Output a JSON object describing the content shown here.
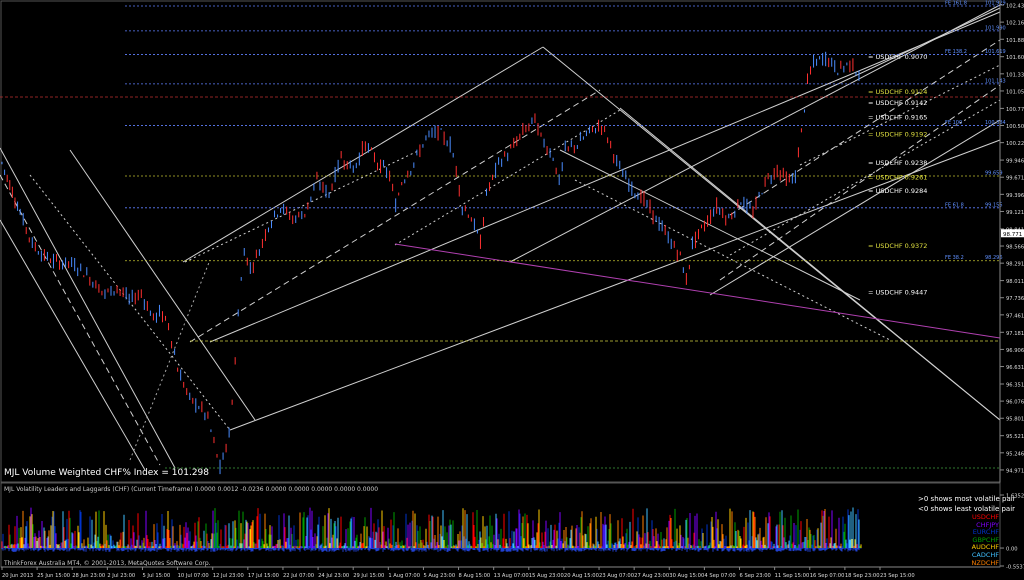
{
  "chart_data": [
    {
      "type": "candlestick",
      "symbol": "USDCHF",
      "indicator_title": "MJL Volume Weighted CHF% Index = 101.298",
      "ylim": [
        94.97,
        102.436
      ],
      "y_ticks": [
        "102.436",
        "102.161",
        "101.886",
        "101.606",
        "101.331",
        "101.056",
        "100.776",
        "100.501",
        "100.226",
        "99.946",
        "99.671",
        "99.396",
        "99.121",
        "98.841",
        "98.566",
        "98.291",
        "98.011",
        "97.736",
        "97.461",
        "97.181",
        "96.906",
        "96.631",
        "96.351",
        "96.076",
        "95.801",
        "95.521",
        "95.246",
        "94.971"
      ],
      "current_price": "98.771",
      "x_ticks": [
        "20 Jun 2013",
        "25 Jun 15:00",
        "28 Jun 23:00",
        "2 Jul 23:00",
        "5 Jul 15:00",
        "10 Jul 07:00",
        "12 Jul 23:00",
        "17 Jul 15:00",
        "22 Jul 07:00",
        "24 Jul 23:00",
        "29 Jul 15:00",
        "1 Aug 07:00",
        "5 Aug 23:00",
        "8 Aug 15:00",
        "13 Aug 07:00",
        "15 Aug 23:00",
        "20 Aug 15:00",
        "23 Aug 07:00",
        "27 Aug 23:00",
        "30 Aug 15:00",
        "4 Sep 07:00",
        "6 Sep 23:00",
        "11 Sep 15:00",
        "16 Sep 07:00",
        "18 Sep 23:00",
        "23 Sep 15:00"
      ],
      "price_path": [
        [
          0,
          99.9
        ],
        [
          6,
          99.1
        ],
        [
          10,
          98.6
        ],
        [
          14,
          98.4
        ],
        [
          18,
          98.3
        ],
        [
          22,
          98.3
        ],
        [
          26,
          98.2
        ],
        [
          30,
          98.0
        ],
        [
          34,
          97.8
        ],
        [
          38,
          97.9
        ],
        [
          42,
          97.7
        ],
        [
          46,
          97.8
        ],
        [
          48,
          97.6
        ],
        [
          50,
          97.4
        ],
        [
          52,
          97.5
        ],
        [
          55,
          97.3
        ],
        [
          58,
          96.6
        ],
        [
          62,
          96.1
        ],
        [
          65,
          96.0
        ],
        [
          68,
          95.8
        ],
        [
          70,
          95.4
        ],
        [
          72,
          95.0
        ],
        [
          74,
          95.3
        ],
        [
          76,
          96.0
        ],
        [
          78,
          97.5
        ],
        [
          80,
          98.5
        ],
        [
          82,
          98.2
        ],
        [
          85,
          98.5
        ],
        [
          88,
          98.9
        ],
        [
          92,
          99.2
        ],
        [
          96,
          99.0
        ],
        [
          100,
          99.1
        ],
        [
          104,
          99.6
        ],
        [
          108,
          99.4
        ],
        [
          112,
          100.0
        ],
        [
          116,
          99.8
        ],
        [
          120,
          100.2
        ],
        [
          124,
          99.9
        ],
        [
          128,
          99.7
        ],
        [
          130,
          99.2
        ],
        [
          132,
          99.6
        ],
        [
          136,
          99.9
        ],
        [
          140,
          100.3
        ],
        [
          144,
          100.4
        ],
        [
          148,
          100.2
        ],
        [
          150,
          99.8
        ],
        [
          152,
          99.2
        ],
        [
          154,
          99.1
        ],
        [
          156,
          98.9
        ],
        [
          158,
          98.6
        ],
        [
          160,
          99.4
        ],
        [
          164,
          99.9
        ],
        [
          168,
          100.1
        ],
        [
          172,
          100.4
        ],
        [
          176,
          100.6
        ],
        [
          178,
          100.3
        ],
        [
          182,
          100.0
        ],
        [
          184,
          99.6
        ],
        [
          186,
          100.1
        ],
        [
          190,
          100.2
        ],
        [
          194,
          100.4
        ],
        [
          198,
          100.5
        ],
        [
          200,
          100.3
        ],
        [
          204,
          99.8
        ],
        [
          208,
          99.5
        ],
        [
          212,
          99.3
        ],
        [
          216,
          99.0
        ],
        [
          220,
          98.7
        ],
        [
          224,
          98.4
        ],
        [
          226,
          98.0
        ],
        [
          228,
          98.6
        ],
        [
          232,
          98.9
        ],
        [
          236,
          99.2
        ],
        [
          240,
          99.0
        ],
        [
          244,
          99.3
        ],
        [
          248,
          99.1
        ],
        [
          252,
          99.6
        ],
        [
          256,
          99.8
        ],
        [
          260,
          99.6
        ],
        [
          262,
          99.7
        ],
        [
          264,
          100.4
        ],
        [
          266,
          101.2
        ],
        [
          268,
          101.5
        ],
        [
          272,
          101.6
        ],
        [
          276,
          101.4
        ],
        [
          280,
          101.5
        ],
        [
          284,
          101.3
        ]
      ],
      "price_range": [
        0,
        284
      ],
      "fib_levels": [
        {
          "label": "FE 161.8",
          "value": "101.929",
          "price": 102.42
        },
        {
          "label": "",
          "value": "101.990",
          "price": 102.02
        },
        {
          "label": "FE 138.2",
          "value": "101.619",
          "price": 101.64
        },
        {
          "label": "",
          "value": "101.143",
          "price": 101.17
        },
        {
          "label": "FE 100",
          "value": "100.384",
          "price": 100.5
        },
        {
          "label": "",
          "value": "99.659",
          "price": 99.69
        },
        {
          "label": "FE 61.8",
          "value": "99.155",
          "price": 99.18
        },
        {
          "label": "FE 38.2",
          "value": "98.296",
          "price": 98.33
        }
      ],
      "cross_labels": [
        {
          "text": "= USDCHF   0.9070",
          "price": 101.6
        },
        {
          "text": "= USDCHF   0.9124",
          "price": 101.04
        },
        {
          "text": "= USDCHF   0.9142",
          "price": 100.86
        },
        {
          "text": "= USDCHF   0.9165",
          "price": 100.63
        },
        {
          "text": "= USDCHF   0.9192",
          "price": 100.36
        },
        {
          "text": "= USDCHF   0.9238",
          "price": 99.9
        },
        {
          "text": "= USDCHF   0.9261",
          "price": 99.67
        },
        {
          "text": "= USDCHF   0.9284",
          "price": 99.45
        },
        {
          "text": "= USDCHF   0.9372",
          "price": 98.57
        },
        {
          "text": "= USDCHF   0.9447",
          "price": 97.82
        }
      ]
    },
    {
      "type": "histogram",
      "title": "MJL Volatility Leaders and Laggards (CHF) (Current Timeframe) 0.0000 0.0012 -0.0236 0.0000 0.0000 0.0000 0.0000 0.0000",
      "y_ticks": [
        "1.6352",
        "0.00",
        "-0.5537"
      ],
      "ylim": [
        -0.5537,
        1.6352
      ],
      "notes": [
        ">0 shows most volatile pair",
        "<0 shows least volatile pair"
      ],
      "legend": [
        {
          "name": "USDCHF",
          "color": "#ff0000"
        },
        {
          "name": "CHFJPY",
          "color": "#7f00ff"
        },
        {
          "name": "EURCHF",
          "color": "#0033cc"
        },
        {
          "name": "GBPCHF",
          "color": "#00a000"
        },
        {
          "name": "AUDCHF",
          "color": "#ffcc00"
        },
        {
          "name": "CADCHF",
          "color": "#40c0ff"
        },
        {
          "name": "NZDCHF",
          "color": "#ff8000"
        }
      ]
    }
  ],
  "footer": {
    "copyright": "ThinkForex Australia MT4, © 2001-2013, MetaQuotes Software Corp."
  }
}
